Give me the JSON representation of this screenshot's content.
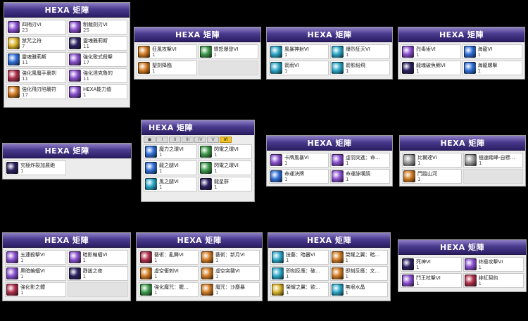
{
  "header": "HEXA 矩陣",
  "hdr_small": "HEXA 矩陣",
  "tabs": [
    "●",
    "I",
    "II",
    "III",
    "IV",
    "V",
    "VI"
  ],
  "panels": {
    "p1": [
      {
        "name": "四柄刃VI",
        "level": "23",
        "icon": "purple"
      },
      {
        "name": "制裁劍刃VI",
        "level": "25",
        "icon": "purple"
      },
      {
        "name": "禁咒之符",
        "level": "7",
        "icon": "yellow"
      },
      {
        "name": "靈魂雅莉斯",
        "level": "11",
        "icon": "dark"
      },
      {
        "name": "靈魂雅莉斯",
        "level": "11",
        "icon": "blue"
      },
      {
        "name": "強化歌式殺擊",
        "level": "17",
        "icon": "purple"
      },
      {
        "name": "強化風魔手裏劍",
        "level": "11",
        "icon": "red"
      },
      {
        "name": "強化達克魯的",
        "level": "11",
        "icon": "purple"
      },
      {
        "name": "強化飛刃陷襲符",
        "level": "17",
        "icon": "orange"
      },
      {
        "name": "HEXA能力值",
        "level": "1",
        "icon": "purple"
      }
    ],
    "p2": [
      {
        "name": "狂風攻擊VI",
        "level": "1",
        "icon": "orange"
      },
      {
        "name": "憤怒爆發VI",
        "level": "1",
        "icon": "green"
      },
      {
        "name": "聖劍降臨",
        "level": "1",
        "icon": "orange"
      },
      {
        "empty": true
      }
    ],
    "p3": [
      {
        "name": "風暴神射VI",
        "level": "1",
        "icon": "cyan"
      },
      {
        "name": "爆烈狂天VI",
        "level": "1",
        "icon": "cyan"
      },
      {
        "name": "箭雨VI",
        "level": "1",
        "icon": "cyan"
      },
      {
        "name": "箭影紛飛",
        "level": "1",
        "icon": "cyan"
      }
    ],
    "p4": [
      {
        "name": "烈毒術VI",
        "level": "1",
        "icon": "purple"
      },
      {
        "name": "海龍VI",
        "level": "1",
        "icon": "blue"
      },
      {
        "name": "龍魂破魚鰓VI",
        "level": "1",
        "icon": "dark"
      },
      {
        "name": "海龍螺擊",
        "level": "1",
        "icon": "blue"
      }
    ],
    "p5": [
      {
        "name": "究極炸裂加農砲",
        "level": "1",
        "icon": "dark"
      }
    ],
    "p6": [
      {
        "name": "魔力之環VI",
        "level": "1",
        "icon": "blue"
      },
      {
        "name": "閃電之環VI",
        "level": "1",
        "icon": "green"
      },
      {
        "name": "龍之腿VI",
        "level": "1",
        "icon": "blue"
      },
      {
        "name": "閃電之環VI",
        "level": "1",
        "icon": "green"
      },
      {
        "name": "風之腿VI",
        "level": "1",
        "icon": "cyan"
      },
      {
        "name": "龍星群",
        "level": "1",
        "icon": "dark"
      }
    ],
    "p7": [
      {
        "name": "卡牌風暴VI",
        "level": "1",
        "icon": "purple"
      },
      {
        "name": "虛羽突進：命…",
        "level": "1",
        "icon": "purple"
      },
      {
        "name": "命運決牌",
        "level": "1",
        "icon": "blue"
      },
      {
        "name": "命運詠嘆調",
        "level": "1",
        "icon": "purple"
      }
    ],
    "p8": [
      {
        "name": "比爾達VI",
        "level": "1",
        "icon": "gray"
      },
      {
        "name": "極速踏峰-自標…",
        "level": "1",
        "icon": "gray"
      },
      {
        "name": "門蹤山河",
        "level": "1",
        "icon": "orange"
      },
      {
        "empty": true
      }
    ],
    "p9": [
      {
        "name": "五連殺擊VI",
        "level": "1",
        "icon": "purple"
      },
      {
        "name": "暗影蝙蝠VI",
        "level": "1",
        "icon": "purple"
      },
      {
        "name": "黑暗蝙蝠VI",
        "level": "1",
        "icon": "purple"
      },
      {
        "name": "靜謐之夜",
        "level": "1",
        "icon": "dark"
      },
      {
        "name": "強化影之體",
        "level": "1",
        "icon": "red"
      },
      {
        "empty": true
      }
    ],
    "p10": [
      {
        "name": "藝術：亂舞VI",
        "level": "1",
        "icon": "red"
      },
      {
        "name": "藝術：新月VI",
        "level": "1",
        "icon": "orange"
      },
      {
        "name": "虛空衝刺VI",
        "level": "1",
        "icon": "orange"
      },
      {
        "name": "虛空突襲VI",
        "level": "1",
        "icon": "orange"
      },
      {
        "name": "強化魔咒：擺…",
        "level": "1",
        "icon": "green"
      },
      {
        "name": "魔咒：沙塵暴",
        "level": "1",
        "icon": "orange"
      }
    ],
    "p11": [
      {
        "name": "技藝：暗器VI",
        "level": "1",
        "icon": "cyan"
      },
      {
        "name": "榮耀之翼：暗…",
        "level": "1",
        "icon": "orange"
      },
      {
        "name": "即刻反應：破…",
        "level": "1",
        "icon": "cyan"
      },
      {
        "name": "即刻反應：文…",
        "level": "1",
        "icon": "orange"
      },
      {
        "name": "榮耀之翼：欲…",
        "level": "1",
        "icon": "yellow"
      },
      {
        "name": "無垠水晶",
        "level": "1",
        "icon": "cyan"
      }
    ],
    "p12": [
      {
        "name": "死神VI",
        "level": "1",
        "icon": "dark"
      },
      {
        "name": "終極攻擊VI",
        "level": "1",
        "icon": "purple"
      },
      {
        "name": "鬥王杖擊VI",
        "level": "1",
        "icon": "purple"
      },
      {
        "name": "緋紅契約",
        "level": "1",
        "icon": "red"
      }
    ]
  },
  "icon_colors": {
    "purple": "#8a4fd0",
    "yellow": "#d9b22a",
    "dark": "#2a2060",
    "blue": "#2f6fd8",
    "red": "#b0304a",
    "orange": "#d07a20",
    "green": "#3d9a4a",
    "cyan": "#2aa7c8",
    "gray": "#9a9a9a"
  }
}
